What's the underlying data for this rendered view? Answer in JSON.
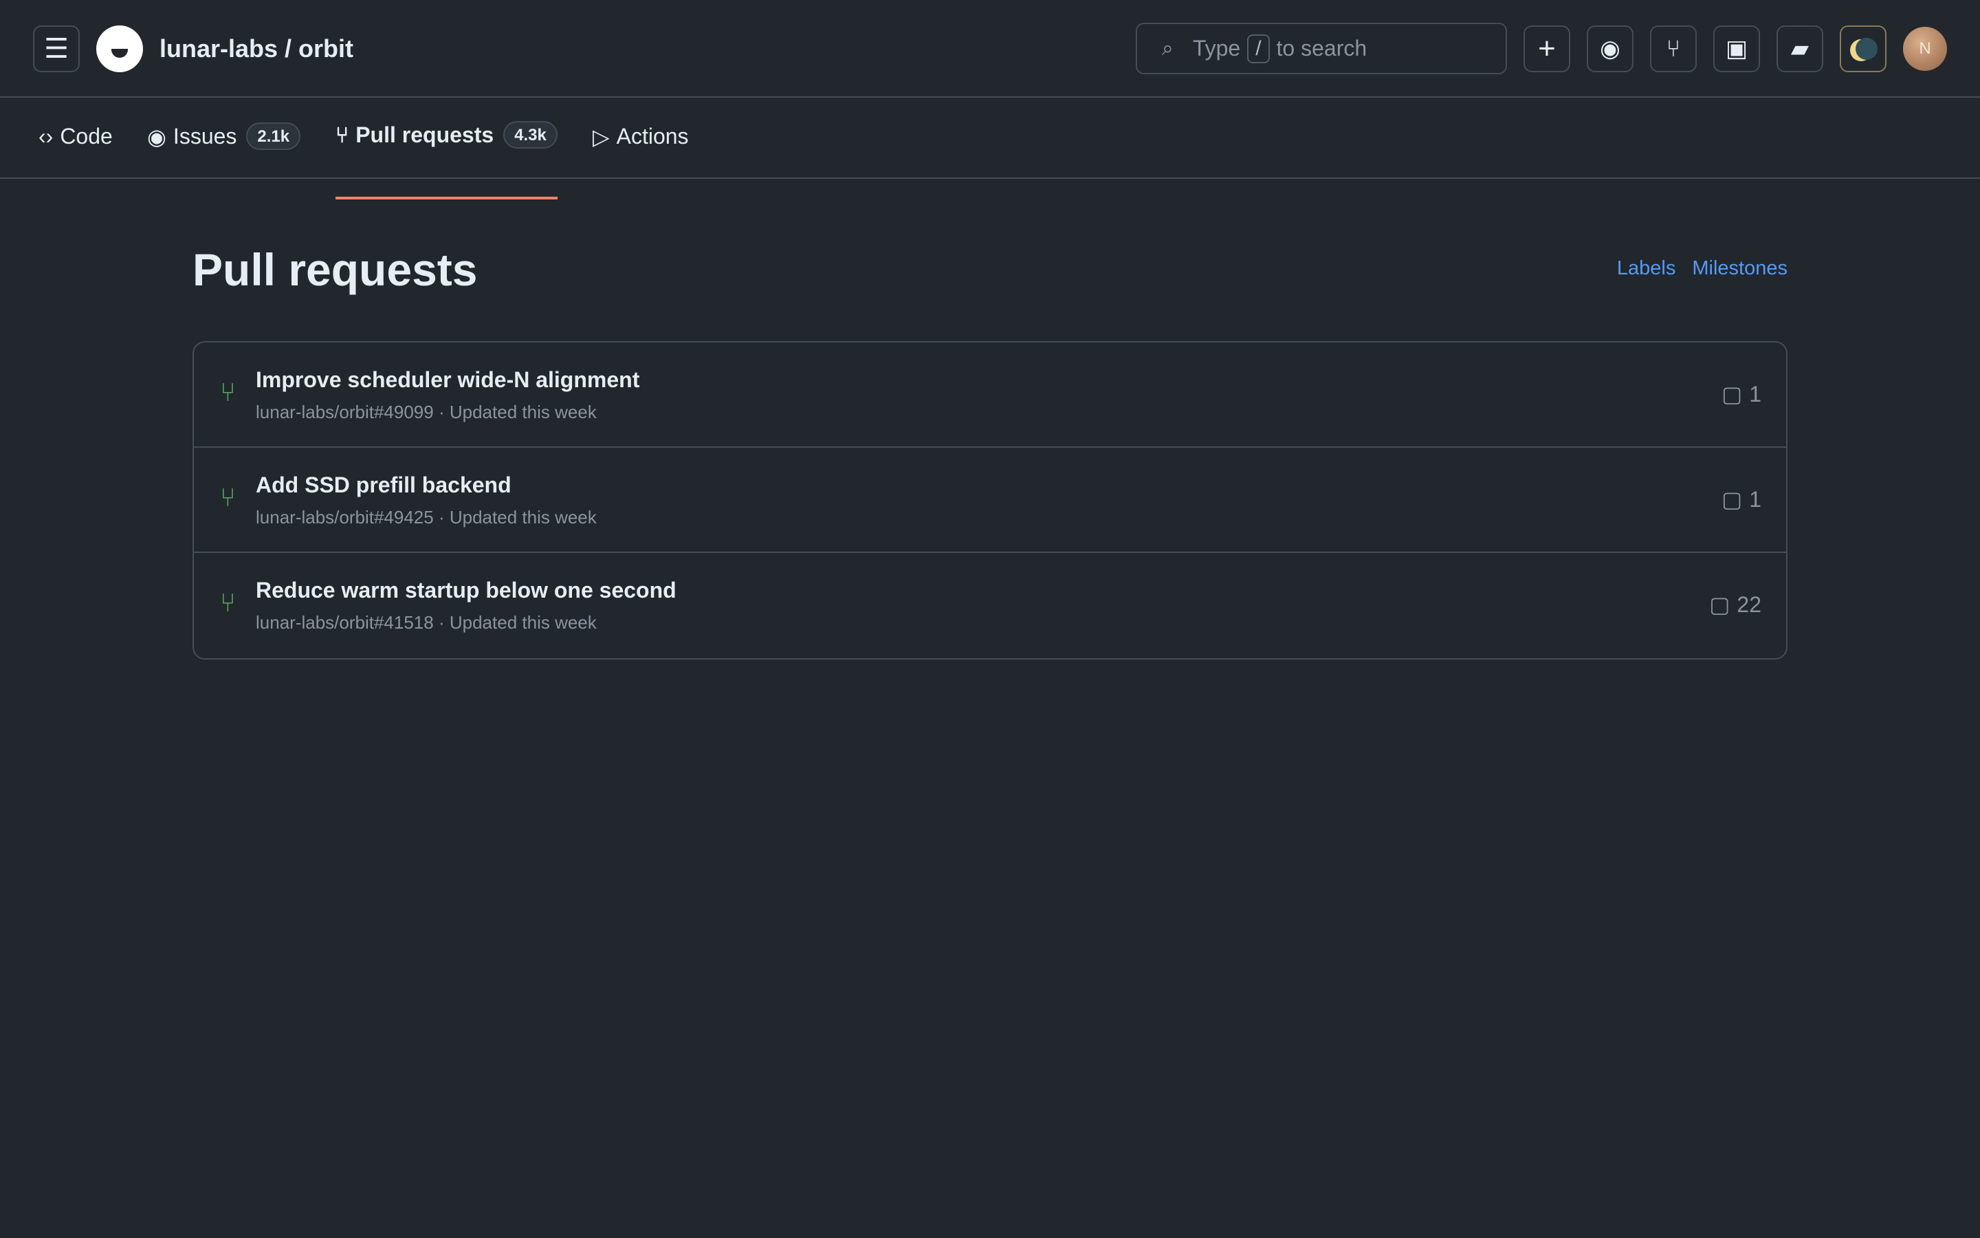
{
  "header": {
    "repo_title": "lunar-labs / orbit",
    "search": {
      "prefix": "Type",
      "key": "/",
      "suffix": "to search"
    },
    "avatar_initial": "N"
  },
  "nav": {
    "code": {
      "glyph": "‹›",
      "label": "Code"
    },
    "issues": {
      "glyph": "◉",
      "label": "Issues",
      "count": "2.1k"
    },
    "pulls": {
      "glyph": "⑂",
      "label": "Pull requests",
      "count": "4.3k"
    },
    "actions": {
      "glyph": "▷",
      "label": "Actions"
    }
  },
  "main": {
    "title": "Pull requests",
    "links": {
      "labels": "Labels",
      "milestones": "Milestones"
    },
    "pull_requests": [
      {
        "title": "Improve scheduler wide-N alignment",
        "ref": "lunar-labs/orbit#49099",
        "updated": "Updated this week",
        "comments": "1"
      },
      {
        "title": "Add SSD prefill backend",
        "ref": "lunar-labs/orbit#49425",
        "updated": "Updated this week",
        "comments": "1"
      },
      {
        "title": "Reduce warm startup below one second",
        "ref": "lunar-labs/orbit#41518",
        "updated": "Updated this week",
        "comments": "22"
      }
    ]
  },
  "colors": {
    "background": "#22272e",
    "border": "#444c56",
    "accent_link": "#539bf5",
    "pr_open": "#57ab5a",
    "active_tab_underline": "#f78166"
  },
  "icons": {
    "menu": "hamburger-icon",
    "search": "search-icon",
    "plus": "plus-icon",
    "issue": "issue-icon",
    "pr": "pull-request-icon",
    "copilot": "copilot-icon",
    "inbox": "inbox-icon",
    "theme": "moon-icon",
    "comment": "comment-icon"
  }
}
